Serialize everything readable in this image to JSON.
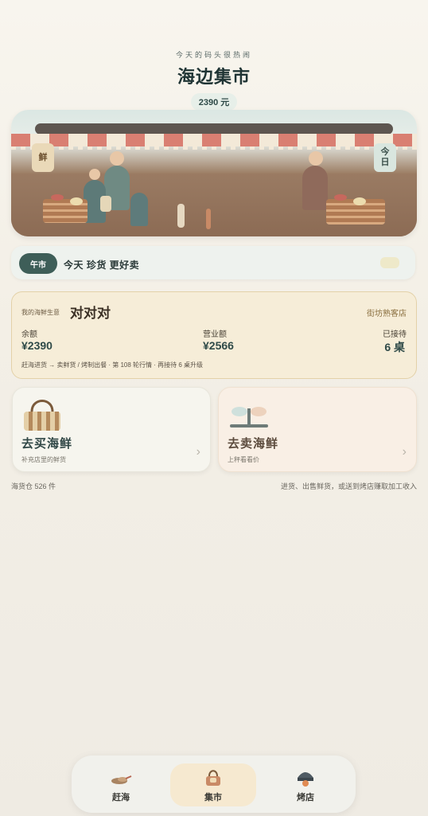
{
  "header": {
    "subtitle": "今天的码头很热闹",
    "title": "海边集市",
    "balance": "2390 元"
  },
  "scene": {
    "sign_left": "鲜",
    "sign_right": "今\n日"
  },
  "ticker": {
    "badge": "午市",
    "text": "今天 珍货 更好卖"
  },
  "business": {
    "label": "我的海鲜生意",
    "name": "对对对",
    "tag": "街坊熟客店",
    "stats": [
      {
        "label": "余额",
        "value": "¥2390"
      },
      {
        "label": "营业额",
        "value": "¥2566"
      },
      {
        "label": "已接待",
        "value": "6 桌"
      }
    ],
    "footer": "赶海进货 → 卖鲜货 / 烤制出餐 · 第 108 轮行情 · 再接待 6 桌升级"
  },
  "actions": {
    "buy": {
      "title": "去买海鲜",
      "sub": "补充店里的鲜货",
      "chevron": "›"
    },
    "sell": {
      "title": "去卖海鲜",
      "sub": "上秤看看价",
      "chevron": "›"
    }
  },
  "inventory": {
    "left": "海货仓 526 件",
    "right": "进货、出售鲜货，或送到烤店赚取加工收入"
  },
  "nav": {
    "items": [
      {
        "label": "赶海",
        "icon": "shell-icon"
      },
      {
        "label": "集市",
        "icon": "basket-icon"
      },
      {
        "label": "烤店",
        "icon": "grill-icon"
      }
    ],
    "active": 1
  }
}
